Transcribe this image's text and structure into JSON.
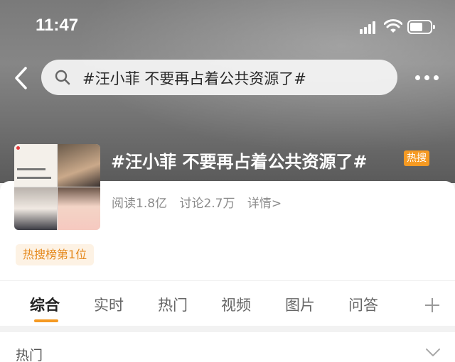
{
  "status_bar": {
    "time": "11:47"
  },
  "search": {
    "query": "#汪小菲 不要再占着公共资源了#"
  },
  "topic": {
    "title": "#汪小菲 不要再占着公共资源了#",
    "badge": "热搜",
    "stats": {
      "reads": "阅读1.8亿",
      "discussions": "讨论2.7万",
      "details": "详情>"
    },
    "rank_tag": "热搜榜第1位"
  },
  "tabs": [
    {
      "label": "综合",
      "active": true
    },
    {
      "label": "实时"
    },
    {
      "label": "热门"
    },
    {
      "label": "视频"
    },
    {
      "label": "图片"
    },
    {
      "label": "问答"
    }
  ],
  "section": {
    "label": "热门"
  },
  "colors": {
    "accent": "#f59a23",
    "badge": "#f59a23",
    "rank_text": "#e58a1f",
    "rank_bg": "#fdf2e4"
  },
  "icons": [
    "back-arrow-icon",
    "search-icon",
    "more-icon",
    "signal-icon",
    "wifi-icon",
    "battery-icon",
    "plus-icon",
    "chevron-down-icon"
  ]
}
